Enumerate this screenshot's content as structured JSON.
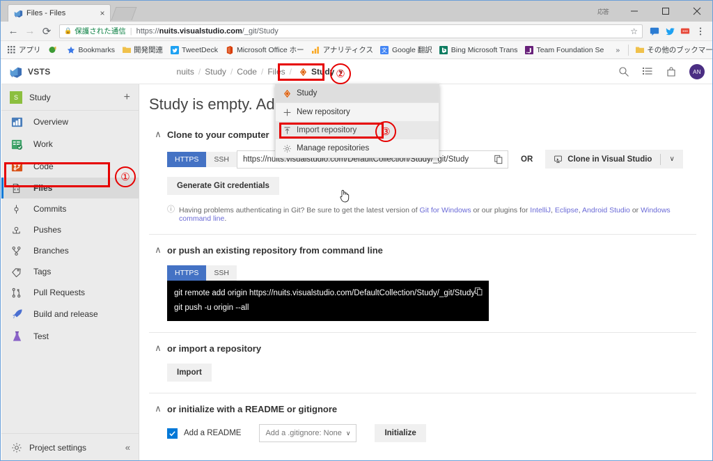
{
  "browser": {
    "tab": {
      "title": "Files - Files",
      "favicon": "vsts-icon",
      "close_label": "×"
    },
    "window_badge": "応答",
    "controls": {
      "minimize": "minimize-icon",
      "maximize": "maximize-icon",
      "close": "close-icon"
    },
    "nav": {
      "back": "back-arrow-icon",
      "forward": "forward-arrow-icon",
      "reload": "reload-icon"
    },
    "omnibox": {
      "secure_label": "保護された通信",
      "url_prefix": "https://",
      "url_host": "nuits.visualstudio.com",
      "url_path": "/_git/Study",
      "star": "star-icon"
    },
    "toolbar_extensions": [
      "pocket-icon",
      "twitter-icon",
      "extension-icon",
      "menu-icon"
    ],
    "bookmarks": [
      {
        "label": "アプリ",
        "icon": "apps-grid-icon"
      },
      {
        "label": "",
        "icon": "green-circle-icon"
      },
      {
        "label": "Bookmarks",
        "icon": "star-blue-icon"
      },
      {
        "label": "開発関連",
        "icon": "folder-icon"
      },
      {
        "label": "TweetDeck",
        "icon": "twitter-icon"
      },
      {
        "label": "Microsoft Office ホー",
        "icon": "office-icon"
      },
      {
        "label": "アナリティクス",
        "icon": "analytics-icon"
      },
      {
        "label": "Google 翻訳",
        "icon": "translate-icon"
      },
      {
        "label": "Bing Microsoft Trans",
        "icon": "bing-icon"
      },
      {
        "label": "Team Foundation Se",
        "icon": "tfs-icon"
      }
    ],
    "bookmarks_overflow": "»",
    "bookmarks_other": {
      "label": "その他のブックマーク",
      "icon": "folder-icon"
    }
  },
  "vsts": {
    "brand": "VSTS",
    "breadcrumb": [
      {
        "label": "nuits"
      },
      {
        "label": "Study"
      },
      {
        "label": "Code"
      },
      {
        "label": "Files"
      }
    ],
    "breadcrumb_separator": "/",
    "repo_picker": {
      "label": "Study",
      "icon": "git-repo-icon",
      "chevron": "∨"
    },
    "header_icons": [
      "search-icon",
      "work-items-icon",
      "marketplace-icon"
    ],
    "avatar_initials": "AN"
  },
  "sidebar": {
    "project": {
      "badge": "S",
      "name": "Study",
      "add_label": "+"
    },
    "items": [
      {
        "label": "Overview",
        "icon": "overview-icon",
        "selected": false
      },
      {
        "label": "Work",
        "icon": "work-icon",
        "selected": false
      },
      {
        "label": "Code",
        "icon": "code-icon",
        "selected": false
      },
      {
        "label": "Files",
        "icon": "files-icon",
        "selected": true
      },
      {
        "label": "Commits",
        "icon": "commits-icon",
        "selected": false
      },
      {
        "label": "Pushes",
        "icon": "pushes-icon",
        "selected": false
      },
      {
        "label": "Branches",
        "icon": "branches-icon",
        "selected": false
      },
      {
        "label": "Tags",
        "icon": "tags-icon",
        "selected": false
      },
      {
        "label": "Pull Requests",
        "icon": "pull-requests-icon",
        "selected": false
      },
      {
        "label": "Build and release",
        "icon": "rocket-icon",
        "selected": false
      },
      {
        "label": "Test",
        "icon": "flask-icon",
        "selected": false
      }
    ],
    "footer": {
      "label": "Project settings",
      "icon": "gear-icon",
      "collapse": "«"
    }
  },
  "main": {
    "page_title": "Study is empty. Add some code!",
    "sections": [
      {
        "title": "Clone to your computer",
        "caret": "∧",
        "protocol_tabs": [
          {
            "label": "HTTPS",
            "active": true
          },
          {
            "label": "SSH",
            "active": false
          }
        ],
        "clone_url": "https://nuits.visualstudio.com/DefaultCollection/Study/_git/Study",
        "copy_icon": "copy-icon",
        "or_label": "OR",
        "clone_vs_label": "Clone in Visual Studio",
        "clone_vs_icon": "visual-studio-icon",
        "clone_vs_chevron": "∨",
        "generate_credentials_label": "Generate Git credentials",
        "hint_prefix": "Having problems authenticating in Git? Be sure to get the latest version of ",
        "hint_links": [
          "Git for Windows",
          "IntelliJ",
          "Eclipse",
          "Android Studio",
          "Windows command line"
        ],
        "hint_mid": " or our plugins for ",
        "hint_sep1": ", ",
        "hint_sep2": ", ",
        "hint_or": " or ",
        "hint_end": "."
      },
      {
        "title": "or push an existing repository from command line",
        "caret": "∧",
        "protocol_tabs": [
          {
            "label": "HTTPS",
            "active": true
          },
          {
            "label": "SSH",
            "active": false
          }
        ],
        "code_lines": [
          "git remote add origin https://nuits.visualstudio.com/DefaultCollection/Study/_git/Study",
          "git push -u origin --all"
        ],
        "copy_icon": "copy-icon"
      },
      {
        "title": "or import a repository",
        "caret": "∧",
        "import_button": "Import"
      },
      {
        "title": "or initialize with a README or gitignore",
        "caret": "∧",
        "readme_checkbox_label": "Add a README",
        "readme_checked": true,
        "gitignore_select": "Add a .gitignore: None",
        "gitignore_chevron": "∨",
        "initialize_button": "Initialize"
      }
    ]
  },
  "dropdown": {
    "items": [
      {
        "label": "Study",
        "icon": "git-repo-icon",
        "state": "current"
      },
      {
        "label": "New repository",
        "icon": "plus-icon",
        "state": "normal"
      },
      {
        "label": "Import repository",
        "icon": "import-arrow-icon",
        "state": "hovered"
      },
      {
        "label": "Manage repositories",
        "icon": "gear-icon",
        "state": "normal"
      }
    ]
  },
  "annotations": {
    "markers": [
      {
        "number": "①",
        "target": "sidebar-item-code"
      },
      {
        "number": "②",
        "target": "repo-picker"
      },
      {
        "number": "③",
        "target": "dropdown-item-import-repository"
      }
    ],
    "color": "#e60000"
  }
}
